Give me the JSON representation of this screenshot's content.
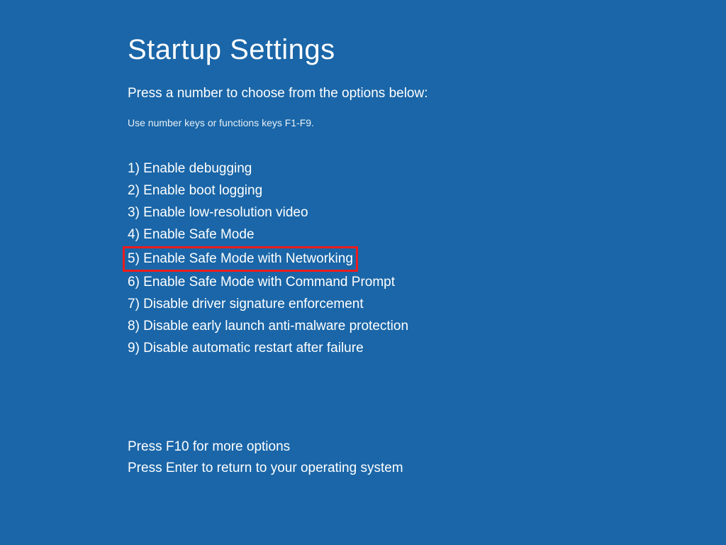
{
  "title": "Startup Settings",
  "instruction": "Press a number to choose from the options below:",
  "hint": "Use number keys or functions keys F1-F9.",
  "options": [
    "1) Enable debugging",
    "2) Enable boot logging",
    "3) Enable low-resolution video",
    "4) Enable Safe Mode",
    "5) Enable Safe Mode with Networking",
    "6) Enable Safe Mode with Command Prompt",
    "7) Disable driver signature enforcement",
    "8) Disable early launch anti-malware protection",
    "9) Disable automatic restart after failure"
  ],
  "highlightedIndex": 4,
  "footer": {
    "moreOptions": "Press F10 for more options",
    "returnOs": "Press Enter to return to your operating system"
  }
}
